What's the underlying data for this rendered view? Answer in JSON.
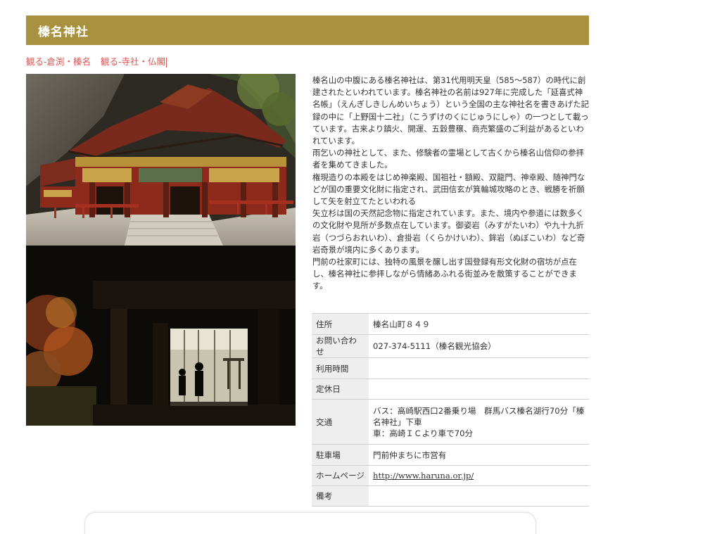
{
  "header": {
    "title": "榛名神社"
  },
  "categories": [
    {
      "label": "観る-倉渕・榛名"
    },
    {
      "label": "観る-寺社・仏閣"
    }
  ],
  "images": [
    {
      "name": "shrine-main-hall-photo"
    },
    {
      "name": "shrine-gate-silhouette-photo"
    }
  ],
  "description": [
    "榛名山の中腹にある榛名神社は、第31代用明天皇（585〜587）の時代に創建されたといわれています。榛名神社の名前は927年に完成した「延喜式神名帳」（えんぎしきしんめいちょう）という全国の主な神社名を書きあげた記録の中に「上野国十二社」（こうずけのくにじゅうにしゃ）の一つとして載っています。古来より鎮火、開運、五穀豊穣、商売繁盛のご利益があるといわれています。",
    "雨乞いの神社として、また、修験者の霊場として古くから榛名山信仰の参拝者を集めてきました。",
    "権現造りの本殿をはじめ神楽殿、国祖社・額殿、双龍門、神幸殿、随神門などが国の重要文化財に指定され、武田信玄が箕輪城攻略のとき、戦勝を祈願して矢を射立てたといわれる",
    "矢立杉は国の天然記念物に指定されています。また、境内や参道には数多くの文化財や見所が多数点在しています。御姿岩（みすがたいわ）や九十九折岩（つづらおれいわ）、倉掛岩（くらかけいわ）、鉾岩（ぬぼこいわ）など奇岩奇景が境内に多くあります。",
    "門前の社家町には、独特の風景を醸し出す国登録有形文化財の宿坊が点在し、榛名神社に参拝しながら情緒あふれる街並みを散策することができます。"
  ],
  "info": {
    "address_label": "住所",
    "address_value": "榛名山町８４９",
    "contact_label": "お問い合わせ",
    "contact_value": "027-374-5111（榛名観光協会）",
    "hours_label": "利用時間",
    "hours_value": "",
    "closed_label": "定休日",
    "closed_value": "",
    "access_label": "交通",
    "access_lines": [
      "バス：高崎駅西口2番乗り場　群馬バス榛名湖行70分「榛名神社」下車",
      "車：高崎ＩＣより車で70分"
    ],
    "parking_label": "駐車場",
    "parking_value": "門前仲まちに市営有",
    "homepage_label": "ホームページ",
    "homepage_value": "http://www.haruna.or.jp/",
    "notes_label": "備考",
    "notes_value": ""
  },
  "colors": {
    "header_bg": "#a8913f",
    "category_link": "#d9534f",
    "table_label_bg": "#eeeeee"
  }
}
